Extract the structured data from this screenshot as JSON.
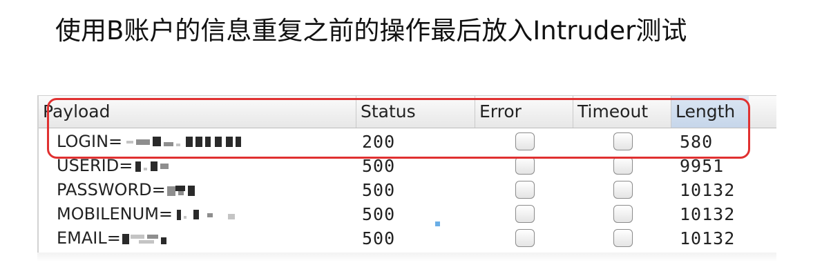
{
  "slide": {
    "title": "使用B账户的信息重复之前的操作最后放入Intruder测试"
  },
  "table": {
    "columns": [
      {
        "label": "Payload"
      },
      {
        "label": "Status"
      },
      {
        "label": "Error"
      },
      {
        "label": "Timeout"
      },
      {
        "label": "Length",
        "sorted": true
      }
    ],
    "rows": [
      {
        "payload": "LOGIN=",
        "status": "200",
        "error": false,
        "timeout": false,
        "length": "580",
        "highlighted": true
      },
      {
        "payload": "USERID=",
        "status": "500",
        "error": false,
        "timeout": false,
        "length": "9951"
      },
      {
        "payload": "PASSWORD=",
        "status": "500",
        "error": false,
        "timeout": false,
        "length": "10132"
      },
      {
        "payload": "MOBILENUM=",
        "status": "500",
        "error": false,
        "timeout": false,
        "length": "10132"
      },
      {
        "payload": "EMAIL=",
        "status": "500",
        "error": false,
        "timeout": false,
        "length": "10132"
      }
    ]
  },
  "colors": {
    "highlight_border": "#e03030",
    "sorted_header": "#c6d6ea"
  }
}
